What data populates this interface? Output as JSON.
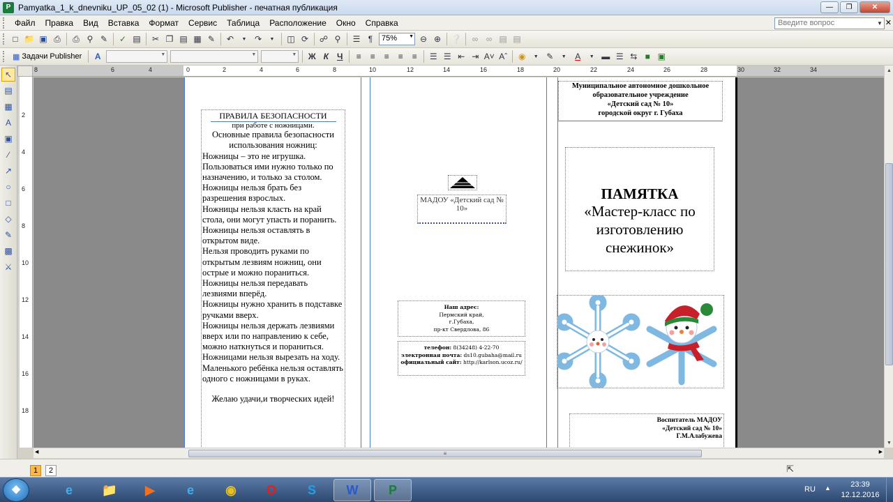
{
  "window": {
    "title": "Pamyatka_1_k_dnevniku_UP_05_02 (1) - Microsoft Publisher - печатная публикация",
    "app_icon": "P"
  },
  "menu": {
    "items": [
      "Файл",
      "Правка",
      "Вид",
      "Вставка",
      "Формат",
      "Сервис",
      "Таблица",
      "Расположение",
      "Окно",
      "Справка"
    ],
    "help_placeholder": "Введите вопрос"
  },
  "toolbar": {
    "zoom": "75%",
    "tasks_label": "Задачи Publisher"
  },
  "format_toolbar": {
    "bold": "Ж",
    "italic": "К",
    "underline": "Ч"
  },
  "ruler": {
    "h_labels": [
      "8",
      "6",
      "4",
      "2",
      "0",
      "2",
      "4",
      "6",
      "8",
      "10",
      "12",
      "14",
      "16",
      "18",
      "20",
      "22",
      "24",
      "26",
      "28",
      "30",
      "32",
      "34"
    ],
    "v_labels": [
      "2",
      "4",
      "6",
      "8",
      "10",
      "12",
      "14",
      "16",
      "18"
    ]
  },
  "document": {
    "rules": {
      "title": "ПРАВИЛА БЕЗОПАСНОСТИ",
      "subtitle": "при работе с ножницами.",
      "heading": "Основные правила безопасности использования ножниц:",
      "items": [
        " Ножницы – это не игрушка. Пользоваться ими нужно только по назначению, и только за столом.",
        " Ножницы нельзя брать без разрешения взрослых.",
        " Ножницы нельзя класть на край стола, они могут упасть и поранить.",
        " Ножницы нельзя оставлять в открытом виде.",
        " Нельзя проводить руками по открытым лезвиям ножниц, они острые и можно пораниться.",
        "  Ножницы нельзя передавать лезвиями вперёд.",
        " Ножницы нужно хранить в подставке ручками вверх.",
        " Ножницы нельзя держать лезвиями вверх или по направлению к себе, можно наткнуться и пораниться.",
        " Ножницами нельзя вырезать на ходу.",
        " Маленького ребёнка нельзя оставлять одного с ножницами в руках."
      ],
      "closing": "Желаю удачи,и творческих идей!"
    },
    "mid_label": "МАДОУ «Детский сад № 10»",
    "address": {
      "heading": "Наш адрес:",
      "lines": [
        "Пермский край,",
        "г.Губаха,",
        "пр-кт Свердлова, 86"
      ]
    },
    "contacts": {
      "phone_label": "телефон:",
      "phone": "8(34248) 4-22-70",
      "email_label": "электронная почта:",
      "email": "ds10.gubaha@mail.ru",
      "site_label": "официальный сайт:",
      "site": "http://karlson.ucoz.ru/"
    },
    "organization": {
      "lines": [
        "Муниципальное автономное дошкольное",
        "образовательное учреждение",
        "«Детский сад № 10»",
        "городской округ г. Губаха"
      ]
    },
    "memo": {
      "title": "ПАМЯТКА",
      "subtitle_lines": [
        "«Мастер-класс по",
        "изготовлению",
        "снежинок»"
      ]
    },
    "author": {
      "lines": [
        "Воспитатель МАДОУ",
        "«Детский сад № 10»",
        "Г.М.Алабужева"
      ]
    }
  },
  "status": {
    "pages": [
      "1",
      "2"
    ],
    "active_page": "1"
  },
  "taskbar": {
    "apps": [
      "ie-icon",
      "explorer-icon",
      "media-player-icon",
      "ie-icon",
      "chrome-icon",
      "opera-icon",
      "skype-icon",
      "word-icon",
      "publisher-icon"
    ],
    "lang": "RU",
    "time": "23:39",
    "date": "12.12.2016"
  },
  "colors": {
    "publisher_green": "#1a7b3a",
    "guide_blue": "#4a7ad0",
    "workspace_gray": "#8a8a8a",
    "active_page": "#f7b94e"
  }
}
